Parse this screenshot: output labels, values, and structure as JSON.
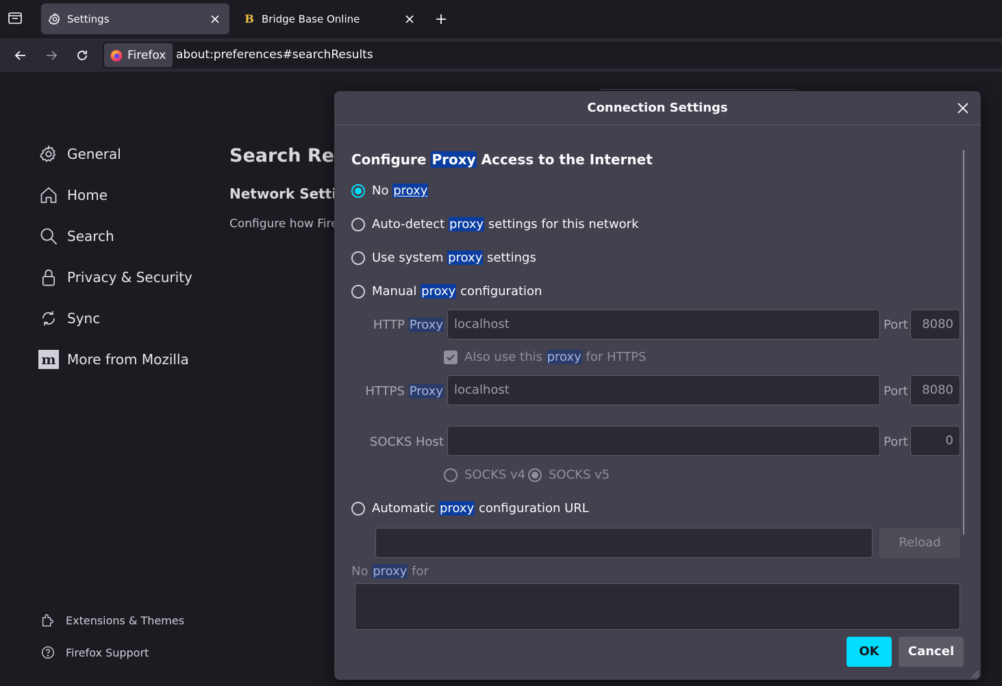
{
  "tabs": [
    {
      "label": "Settings",
      "icon": "gear-icon"
    },
    {
      "label": "Bridge Base Online",
      "icon": "bbo-b-icon",
      "icon_glyph": "B"
    }
  ],
  "urlbar": {
    "identity_label": "Firefox",
    "url": "about:preferences#searchResults"
  },
  "sidebar": {
    "items": [
      {
        "label": "General",
        "icon": "gear-icon"
      },
      {
        "label": "Home",
        "icon": "home-icon"
      },
      {
        "label": "Search",
        "icon": "search-icon"
      },
      {
        "label": "Privacy & Security",
        "icon": "lock-icon"
      },
      {
        "label": "Sync",
        "icon": "sync-icon"
      },
      {
        "label": "More from Mozilla",
        "icon": "mozilla-m-icon"
      }
    ],
    "footer": [
      {
        "label": "Extensions & Themes",
        "icon": "puzzle-icon"
      },
      {
        "label": "Firefox Support",
        "icon": "help-icon"
      }
    ]
  },
  "page": {
    "title": "Search Results",
    "network_heading": "Network Settings",
    "network_description": "Configure how Firefox connects to the internet."
  },
  "dialog": {
    "title": "Connection Settings",
    "section_title": {
      "before": "Configure ",
      "highlight": "Proxy",
      "after": " Access to the Internet"
    },
    "options": {
      "no_proxy": {
        "before": "No ",
        "highlight": "proxy",
        "after": "",
        "checked": true
      },
      "auto_detect": {
        "before": "Auto-detect ",
        "highlight": "proxy",
        "after": " settings for this network",
        "checked": false
      },
      "system": {
        "before": "Use system ",
        "highlight": "proxy",
        "after": " settings",
        "checked": false
      },
      "manual": {
        "before": "Manual ",
        "highlight": "proxy",
        "after": " configuration",
        "checked": false
      },
      "automatic_url": {
        "before": "Automatic ",
        "highlight": "proxy",
        "after": " configuration URL",
        "checked": false
      }
    },
    "http": {
      "label_before": "HTTP ",
      "label_highlight": "Proxy",
      "value": "localhost",
      "port_label": "Port",
      "port": "8080"
    },
    "also_https": {
      "before": "Also use this ",
      "highlight": "proxy",
      "after": " for HTTPS",
      "checked": true
    },
    "https": {
      "label_before": "HTTPS ",
      "label_highlight": "Proxy",
      "value": "localhost",
      "port_label": "Port",
      "port": "8080"
    },
    "socks": {
      "label": "SOCKS Host",
      "value": "",
      "port_label": "Port",
      "port": "0",
      "v4_label": "SOCKS v4",
      "v5_label": "SOCKS v5",
      "selected": "v5"
    },
    "autoconfig_url": "",
    "reload_label": "Reload",
    "no_proxy_for": {
      "before": "No ",
      "highlight": "proxy",
      "after": " for"
    },
    "no_proxy_value": "",
    "ok_label": "OK",
    "cancel_label": "Cancel"
  },
  "colors": {
    "accent": "#00ddff",
    "highlight": "#0a3d9f",
    "dialog_bg": "#42414d",
    "page_bg": "#1c1b22"
  }
}
